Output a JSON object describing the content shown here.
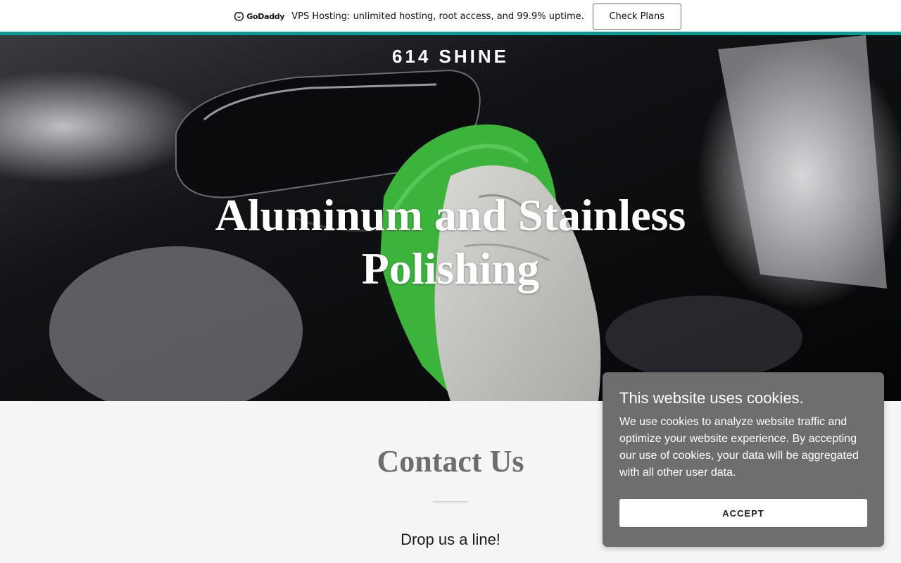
{
  "promo": {
    "logo_text": "GoDaddy",
    "message": "VPS Hosting: unlimited hosting, root access, and 99.9% uptime.",
    "button_label": "Check Plans",
    "accent_color": "#0b9b93"
  },
  "hero": {
    "site_title": "614 SHINE",
    "heading": "Aluminum and Stainless Polishing"
  },
  "contact": {
    "title": "Contact Us",
    "subtitle": "Drop us a line!"
  },
  "cookie_banner": {
    "title": "This website uses cookies.",
    "body": "We use cookies to analyze website traffic and optimize your website experience. By accepting our use of cookies, your data will be aggregated with all other user data.",
    "accept_label": "ACCEPT"
  }
}
